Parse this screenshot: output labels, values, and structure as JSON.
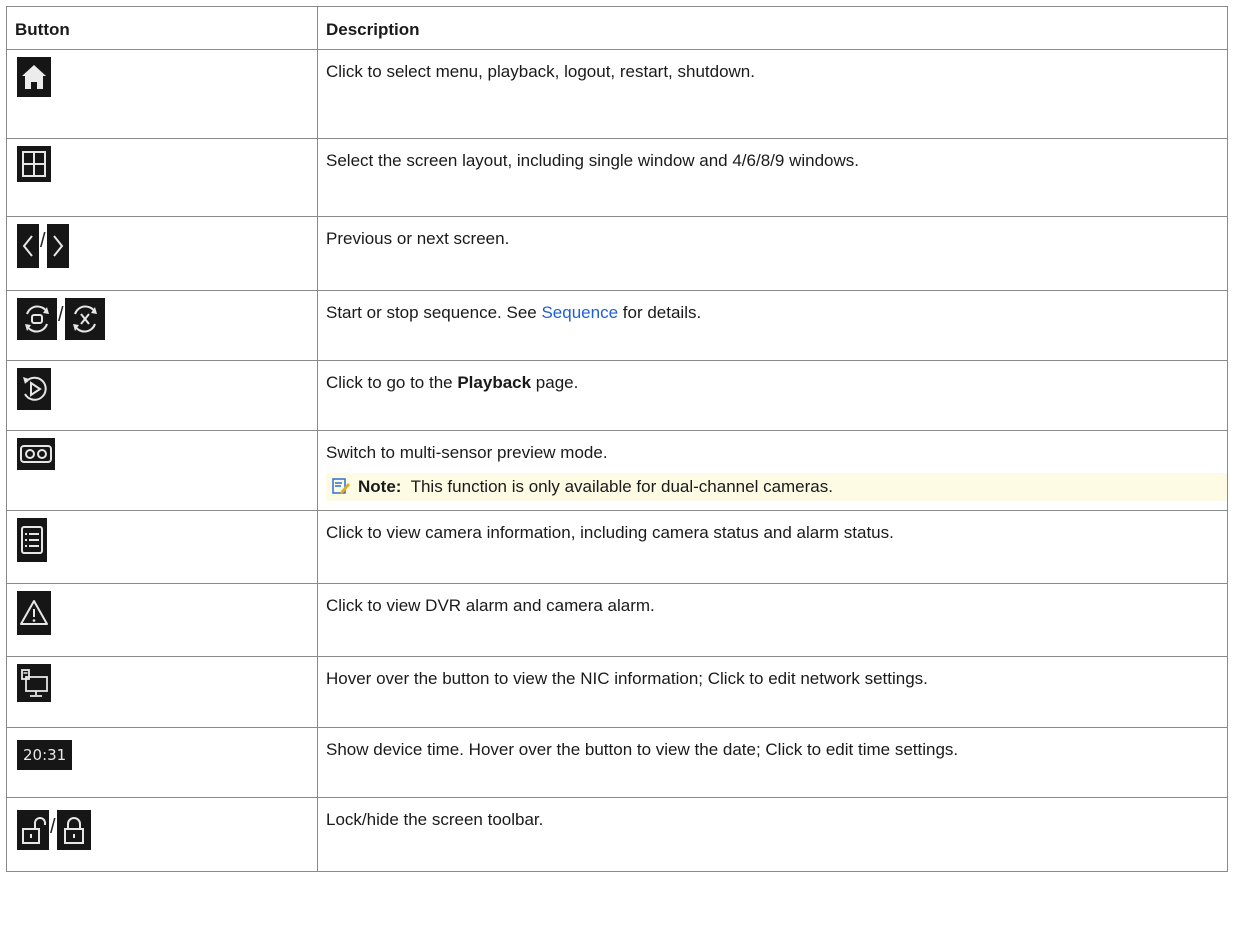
{
  "headers": {
    "button": "Button",
    "description": "Description"
  },
  "rows": [
    {
      "icon": "home-icon",
      "text": "Click to select menu, playback, logout, restart, shutdown."
    },
    {
      "icon": "screen-layout-icon",
      "text": "Select the screen layout, including single window and 4/6/8/9 windows."
    },
    {
      "icons": [
        "chevron-left-icon",
        "chevron-right-icon"
      ],
      "separator": "/",
      "text": "Previous or next screen."
    },
    {
      "icons": [
        "sequence-start-icon",
        "sequence-stop-icon"
      ],
      "separator": "/",
      "text_before": "Start or stop sequence. See ",
      "link": "Sequence",
      "text_after": " for details."
    },
    {
      "icon": "playback-icon",
      "text_before": "Click to go to the ",
      "bold": "Playback",
      "text_after": " page."
    },
    {
      "icon": "multi-sensor-icon",
      "text": "Switch to multi-sensor preview mode.",
      "note_label": "Note:",
      "note_text": "This function is only available for dual-channel cameras."
    },
    {
      "icon": "camera-info-list-icon",
      "text": "Click to view camera information, including camera status and alarm status."
    },
    {
      "icon": "alarm-warning-icon",
      "text": "Click to view DVR alarm and camera alarm."
    },
    {
      "icon": "network-icon",
      "text": "Hover over the button to view the NIC information; Click to edit network settings."
    },
    {
      "time_label": "20:31",
      "text": "Show device time. Hover over the button to view the date; Click to edit time settings."
    },
    {
      "icons": [
        "unlock-icon",
        "lock-icon"
      ],
      "separator": "/",
      "text": "Lock/hide the screen toolbar."
    }
  ],
  "colors": {
    "icon_bg": "#161616",
    "icon_fg": "#e6e6e6",
    "link": "#1f5fd6",
    "note_bg": "#fdfbe4"
  }
}
